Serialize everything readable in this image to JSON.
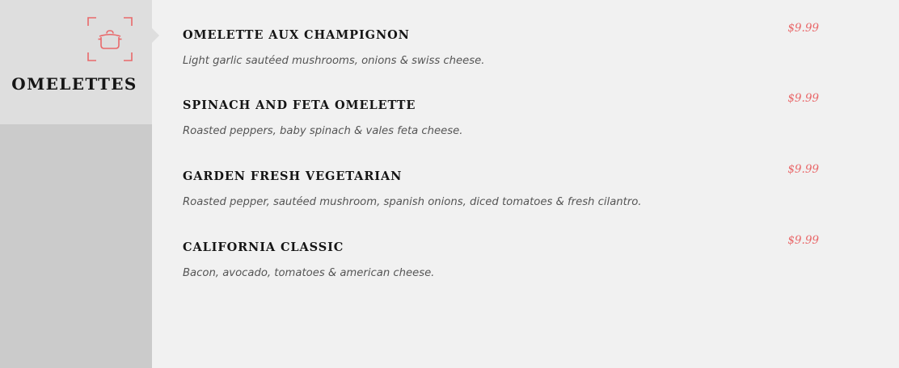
{
  "category": {
    "title": "OMELETTES",
    "icon": "cooking-pot-icon"
  },
  "colors": {
    "accent": "#e9686a",
    "sidebar": "#cbcbcb",
    "category_panel": "#dedede",
    "background": "#f1f1f1",
    "heading": "#151515",
    "description": "#555555"
  },
  "menu": {
    "items": [
      {
        "name": "OMELETTE AUX CHAMPIGNON",
        "description": "Light garlic sautéed mushrooms, onions & swiss cheese.",
        "price": "$9.99"
      },
      {
        "name": "SPINACH AND FETA OMELETTE",
        "description": "Roasted peppers, baby spinach & vales feta cheese.",
        "price": "$9.99"
      },
      {
        "name": "GARDEN FRESH VEGETARIAN",
        "description": "Roasted pepper, sautéed mushroom, spanish onions, diced tomatoes & fresh cilantro.",
        "price": "$9.99"
      },
      {
        "name": "CALIFORNIA CLASSIC",
        "description": "Bacon, avocado, tomatoes & american cheese.",
        "price": "$9.99"
      }
    ]
  }
}
